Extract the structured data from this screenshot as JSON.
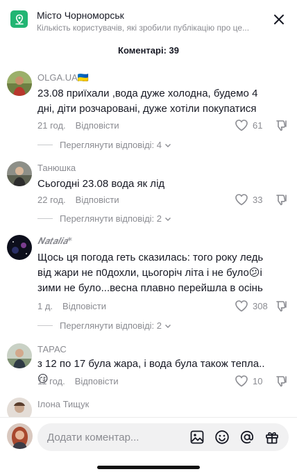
{
  "header": {
    "title": "Місто Чорноморськ",
    "subtitle": "Кількість користувачів, які зробили публікацію про це...",
    "location_icon": "map-pin-icon",
    "close_icon": "close-icon"
  },
  "comments_count_label": "Коментарі: 39",
  "comments": [
    {
      "username": "OLGA.UA🇺🇦",
      "text": "23.08 приїхали ,вода дуже холодна, будемо 4 дні, діти розчаровані, дуже хотіли покупатися",
      "time": "21 год.",
      "reply_label": "Відповісти",
      "likes": "61",
      "view_replies": "Переглянути відповіді: 4"
    },
    {
      "username": "Танюшка",
      "text": "Сьогодні 23.08 вода як лід",
      "time": "22 год.",
      "reply_label": "Відповісти",
      "likes": "33",
      "view_replies": "Переглянути відповіді: 2"
    },
    {
      "username": "𝑵𝒂𝒕𝒂𝒍𝒊𝒂*",
      "text": "Щось ця погода геть сказилась: того року ледь від жари не п0дохли, цьогоріч літа і не було😕і зими не було...весна плавно перейшла в осінь",
      "time": "1 д.",
      "reply_label": "Відповісти",
      "likes": "308",
      "view_replies": "Переглянути відповіді: 2"
    },
    {
      "username": "ТАРАС",
      "text": "з 12 по 17 була жара, і вода була також тепла..😏",
      "time": "11 год.",
      "reply_label": "Відповісти",
      "likes": "10"
    },
    {
      "username": "Ілона Тищук"
    }
  ],
  "composer": {
    "placeholder": "Додати коментар...",
    "icons": [
      "image-icon",
      "emoji-icon",
      "mention-icon",
      "gift-icon"
    ]
  },
  "colors": {
    "accent": "#22b573",
    "muted": "#8a8b91",
    "text": "#161823"
  }
}
